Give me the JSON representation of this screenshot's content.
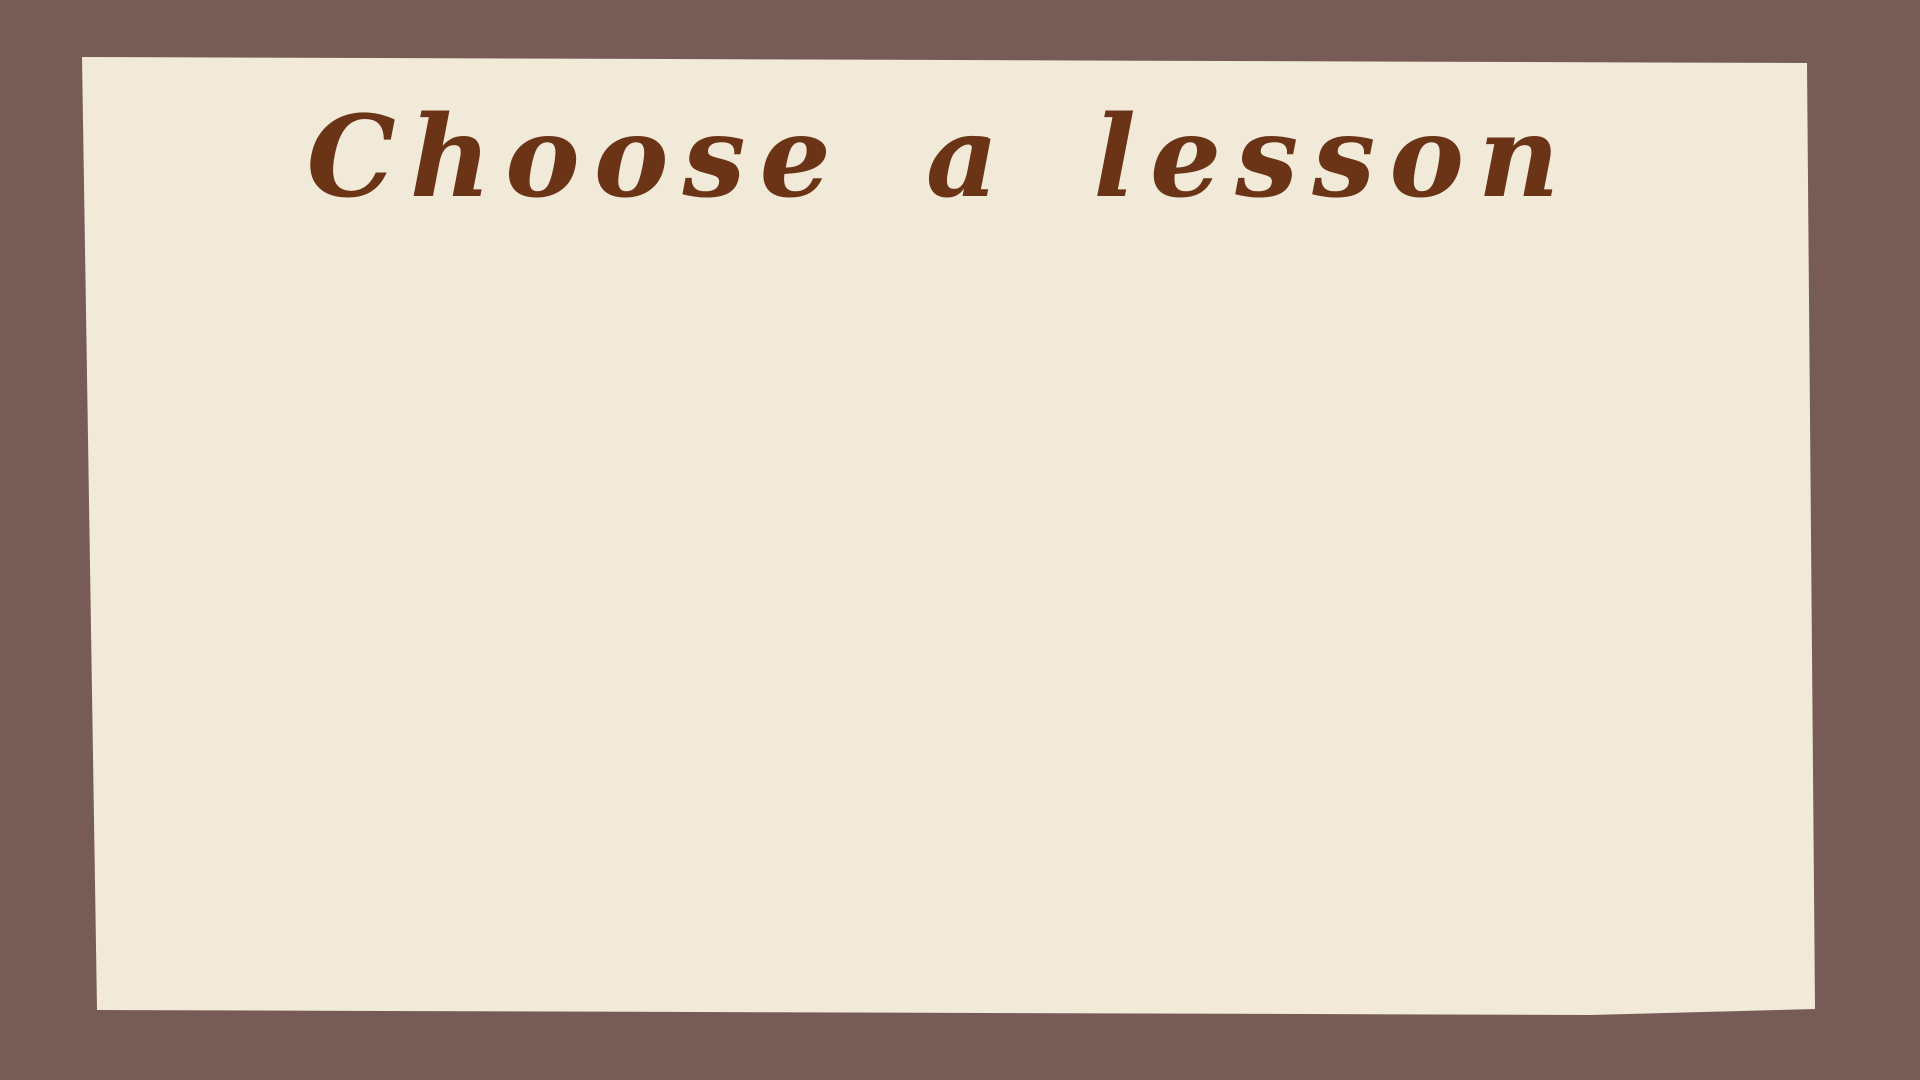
{
  "screen": {
    "title": "Choose a lesson"
  },
  "colors": {
    "background": "#775b57",
    "paper": "#f1ead8",
    "title_ink": "#6b3417"
  }
}
